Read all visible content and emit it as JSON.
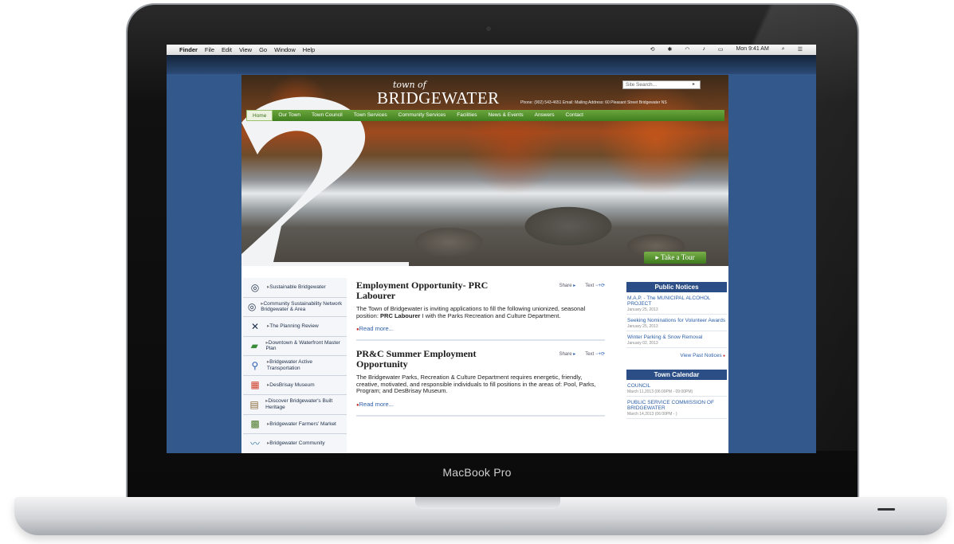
{
  "device": {
    "brand_label": "MacBook Pro"
  },
  "menubar": {
    "app_name": "Finder",
    "menus": [
      "File",
      "Edit",
      "View",
      "Go",
      "Window",
      "Help"
    ],
    "clock": "Mon 9:41 AM"
  },
  "site": {
    "logo_prefix": "town of",
    "logo_name": "BRIDGEWATER",
    "search_placeholder": "Site Search...",
    "contact_line": "Phone: (902) 543-4651 Email: Mailing Address: 60 Pleasant Street Bridgewater NS",
    "nav": [
      "Home",
      "Our Town",
      "Town Council",
      "Town Services",
      "Community Services",
      "Facilities",
      "News & Events",
      "Answers",
      "Contact"
    ],
    "tour_button": "Take a Tour"
  },
  "sidebar": {
    "items": [
      {
        "label": "Sustainable Bridgewater",
        "icon": "spiral-icon"
      },
      {
        "label": "Community Sustainability Network Bridgewater & Area",
        "icon": "spiral-icon"
      },
      {
        "label": "The Planning Review",
        "icon": "arrows-icon"
      },
      {
        "label": "Downtown & Waterfront Master Plan",
        "icon": "map-icon"
      },
      {
        "label": "Bridgewater Active Transportation",
        "icon": "cyclist-icon"
      },
      {
        "label": "DesBrisay Museum",
        "icon": "museum-icon"
      },
      {
        "label": "Discover Bridgewater's Built Heritage",
        "icon": "heritage-icon"
      },
      {
        "label": "Bridgewater Farmers' Market",
        "icon": "market-icon"
      },
      {
        "label": "Bridgewater Community",
        "icon": "community-icon"
      }
    ]
  },
  "articles": [
    {
      "title": "Employment Opportunity- PRC Labourer",
      "share": "Share",
      "text_size": "Text",
      "body_prefix": "The Town of Bridgewater is inviting applications to fill the following unionized, seasonal position:",
      "body_bold": "PRC Labourer",
      "body_suffix": "I with the Parks Recreation and Culture Department.",
      "read_more": "Read more..."
    },
    {
      "title": "PR&C Summer Employment Opportunity",
      "share": "Share",
      "text_size": "Text",
      "body": "The Bridgewater Parks, Recreation & Culture Department requires energetic, friendly, creative, motivated, and responsible individuals to fill positions in the areas of: Pool, Parks, Program; and DesBrisay Museum.",
      "read_more": "Read more..."
    }
  ],
  "public_notices": {
    "title": "Public Notices",
    "items": [
      {
        "title": "M.A.P. - The MUNICIPAL ALCOHOL PROJECT",
        "date": "January 25, 2013"
      },
      {
        "title": "Seeking Nominations for Volunteer Awards",
        "date": "January 25, 2013"
      },
      {
        "title": "Winter Parking & Snow Removal",
        "date": "January 02, 2013"
      }
    ],
    "view_past": "View Past Notices"
  },
  "town_calendar": {
    "title": "Town Calendar",
    "items": [
      {
        "title": "COUNCIL",
        "date": "March 11,2013 (06:00PM - 09:00PM)"
      },
      {
        "title": "PUBLIC SERVICE COMMISSION OF BRIDGEWATER",
        "date": "March 14,2013 (06:00PM - )"
      }
    ]
  }
}
